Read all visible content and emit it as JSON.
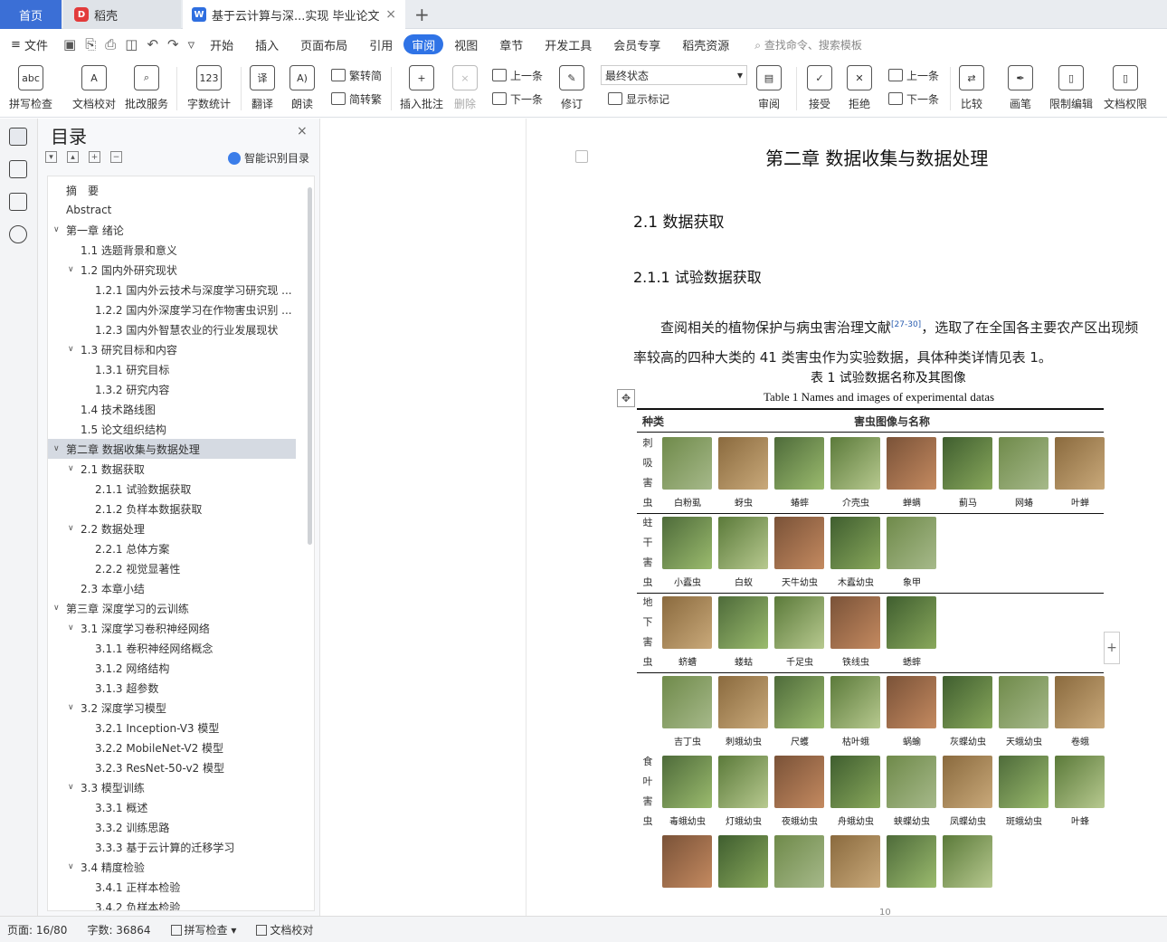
{
  "tabs": {
    "home": "首页",
    "daoke": "稻壳",
    "doc": "基于云计算与深...实现 毕业论文",
    "close": "×",
    "plus": "+"
  },
  "menu": {
    "file": "文件",
    "items": [
      "开始",
      "插入",
      "页面布局",
      "引用",
      "审阅",
      "视图",
      "章节",
      "开发工具",
      "会员专享",
      "稻壳资源"
    ],
    "active_index": 4,
    "search": "查找命令、搜索模板"
  },
  "ribbon": {
    "spell": "拼写检查",
    "doccheck": "文档校对",
    "batch": "批改服务",
    "wordcount": "字数统计",
    "translate": "翻译",
    "read": "朗读",
    "trad": "繁转简",
    "simp": "简转繁",
    "comment": "插入批注",
    "delete": "删除",
    "prev": "上一条",
    "next": "下一条",
    "revise": "修订",
    "state": "最终状态",
    "showmarks": "显示标记",
    "review": "审阅",
    "accept": "接受",
    "reject": "拒绝",
    "prev2": "上一条",
    "next2": "下一条",
    "compare": "比较",
    "ink": "画笔",
    "restrict": "限制编辑",
    "perm": "文档权限"
  },
  "toc": {
    "title": "目录",
    "smart": "智能识别目录",
    "close": "×",
    "items": [
      {
        "t": "摘　要",
        "l": 1,
        "c": ""
      },
      {
        "t": "Abstract",
        "l": 1,
        "c": ""
      },
      {
        "t": "第一章  绪论",
        "l": 1,
        "c": "v"
      },
      {
        "t": "1.1 选题背景和意义",
        "l": 2,
        "c": ""
      },
      {
        "t": "1.2  国内外研究现状",
        "l": 2,
        "c": "v"
      },
      {
        "t": "1.2.1  国内外云技术与深度学习研究现 ...",
        "l": 3,
        "c": ""
      },
      {
        "t": "1.2.2  国内外深度学习在作物害虫识别 ...",
        "l": 3,
        "c": ""
      },
      {
        "t": "1.2.3  国内外智慧农业的行业发展现状",
        "l": 3,
        "c": ""
      },
      {
        "t": "1.3  研究目标和内容",
        "l": 2,
        "c": "v"
      },
      {
        "t": "1.3.1  研究目标",
        "l": 3,
        "c": ""
      },
      {
        "t": "1.3.2  研究内容",
        "l": 3,
        "c": ""
      },
      {
        "t": "1.4  技术路线图",
        "l": 2,
        "c": ""
      },
      {
        "t": "1.5  论文组织结构",
        "l": 2,
        "c": ""
      },
      {
        "t": "第二章  数据收集与数据处理",
        "l": 1,
        "c": "v",
        "sel": true
      },
      {
        "t": "2.1  数据获取",
        "l": 2,
        "c": "v"
      },
      {
        "t": "2.1.1  试验数据获取",
        "l": 3,
        "c": ""
      },
      {
        "t": "2.1.2  负样本数据获取",
        "l": 3,
        "c": ""
      },
      {
        "t": "2.2  数据处理",
        "l": 2,
        "c": "v"
      },
      {
        "t": "2.2.1  总体方案",
        "l": 3,
        "c": ""
      },
      {
        "t": "2.2.2  视觉显著性",
        "l": 3,
        "c": ""
      },
      {
        "t": "2.3  本章小结",
        "l": 2,
        "c": ""
      },
      {
        "t": "第三章  深度学习的云训练",
        "l": 1,
        "c": "v"
      },
      {
        "t": "3.1  深度学习卷积神经网络",
        "l": 2,
        "c": "v"
      },
      {
        "t": "3.1.1  卷积神经网络概念",
        "l": 3,
        "c": ""
      },
      {
        "t": "3.1.2  网络结构",
        "l": 3,
        "c": ""
      },
      {
        "t": "3.1.3  超参数",
        "l": 3,
        "c": ""
      },
      {
        "t": "3.2  深度学习模型",
        "l": 2,
        "c": "v"
      },
      {
        "t": "3.2.1 Inception-V3 模型",
        "l": 3,
        "c": ""
      },
      {
        "t": "3.2.2 MobileNet-V2 模型",
        "l": 3,
        "c": ""
      },
      {
        "t": "3.2.3 ResNet-50-v2 模型",
        "l": 3,
        "c": ""
      },
      {
        "t": "3.3  模型训练",
        "l": 2,
        "c": "v"
      },
      {
        "t": "3.3.1  概述",
        "l": 3,
        "c": ""
      },
      {
        "t": "3.3.2  训练思路",
        "l": 3,
        "c": ""
      },
      {
        "t": "3.3.3  基于云计算的迁移学习",
        "l": 3,
        "c": ""
      },
      {
        "t": "3.4  精度检验",
        "l": 2,
        "c": "v"
      },
      {
        "t": "3.4.1  正样本检验",
        "l": 3,
        "c": ""
      },
      {
        "t": "3.4.2  负样本检验",
        "l": 3,
        "c": ""
      }
    ]
  },
  "doc": {
    "chapter": "第二章  数据收集与数据处理",
    "s21": "2.1  数据获取",
    "s211": "2.1.1  试验数据获取",
    "para_a": "查阅相关的植物保护与病虫害治理文献",
    "cite": "[27-30]",
    "para_b": "，选取了在全国各主要农产区出现频率较高的四种大类的 41 类害虫作为实验数据，具体种类详情见表 1。",
    "cap_cn": "表 1  试验数据名称及其图像",
    "cap_en": "Table 1 Names and images of experimental datas",
    "th_cat": "种类",
    "th_img": "害虫图像与名称",
    "groups": [
      {
        "cat": "刺吸害虫",
        "names": [
          "白粉虱",
          "蚜虫",
          "蝽蟀",
          "介壳虫",
          "蝉螨",
          "蓟马",
          "网蝽",
          "叶蝉"
        ]
      },
      {
        "cat": "蛀干害虫",
        "names": [
          "小蠹虫",
          "白蚁",
          "天牛幼虫",
          "木蠹幼虫",
          "象甲"
        ]
      },
      {
        "cat": "地下害虫",
        "names": [
          "蛴螬",
          "蝼蛄",
          "千足虫",
          "铁线虫",
          "蟋蟀"
        ]
      },
      {
        "cat": "食叶害虫",
        "names": [
          "吉丁虫",
          "刺蛾幼虫",
          "尺蠖",
          "枯叶蛾",
          "蜗蝓",
          "灰蝶幼虫",
          "天蛾幼虫",
          "卷蛾",
          "毒蛾幼虫",
          "灯蛾幼虫",
          "夜蛾幼虫",
          "舟蛾幼虫",
          "蛱蝶幼虫",
          "凤蝶幼虫",
          "斑蛾幼虫",
          "叶蜂"
        ]
      }
    ],
    "page_number": "10"
  },
  "status": {
    "page": "页面: 16/80",
    "words": "字数: 36864",
    "spell": "拼写检查",
    "doccheck": "文档校对"
  }
}
